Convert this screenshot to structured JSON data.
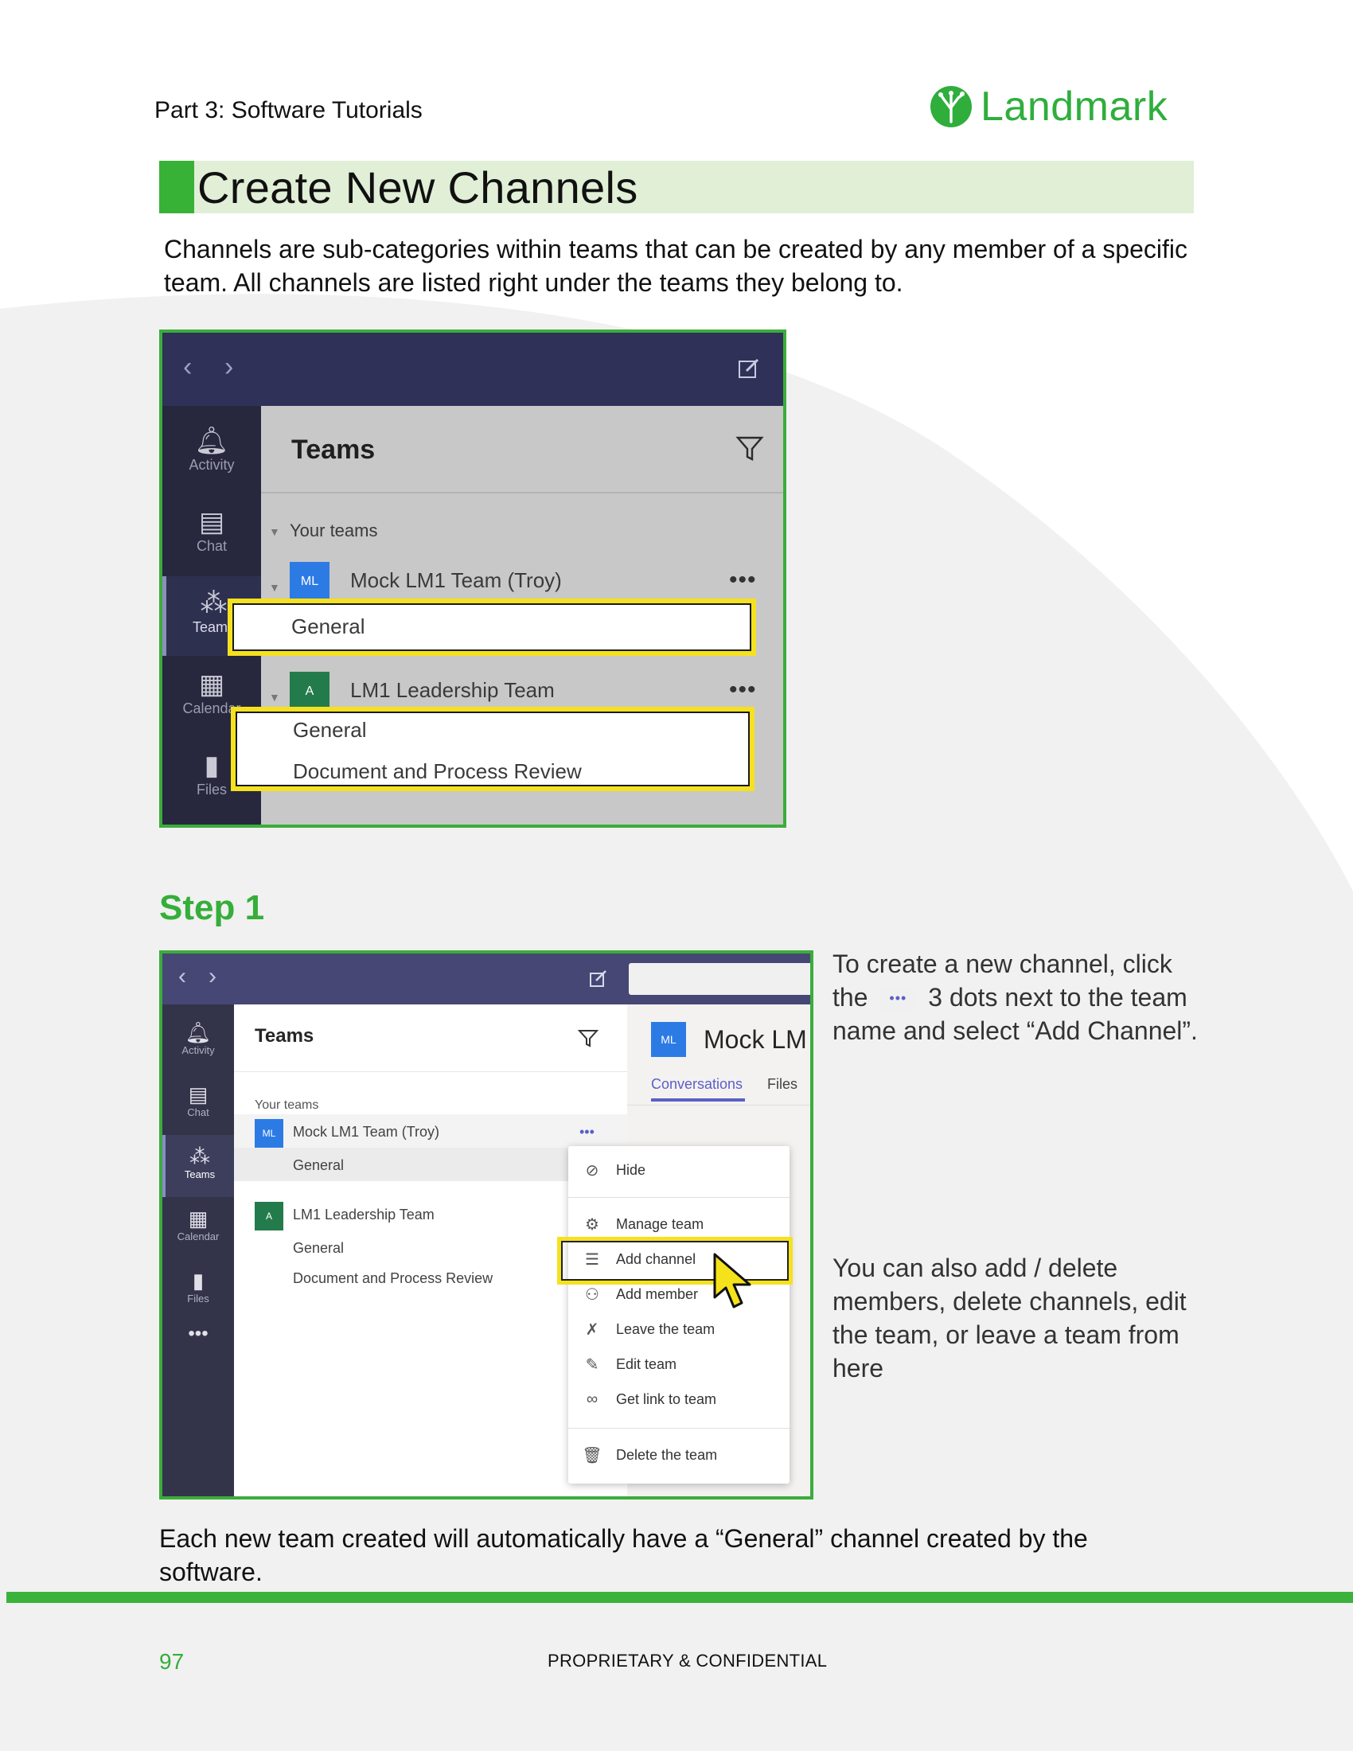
{
  "header": {
    "section_label": "Part 3: Software Tutorials",
    "logo_text": "Landmark",
    "logo_icon": "tree-icon"
  },
  "title": "Create New Channels",
  "intro": "Channels are sub-categories within teams that can be created by any member of a specific team. All channels are listed right under the teams they belong to.",
  "screenshot1": {
    "rail": [
      "Activity",
      "Chat",
      "Teams",
      "Calendar",
      "Files"
    ],
    "heading": "Teams",
    "section": "Your teams",
    "team1": {
      "avatar": "ML",
      "name": "Mock LM1 Team (Troy)",
      "channels": [
        "General"
      ]
    },
    "team2": {
      "avatar": "A",
      "name": "LM1 Leadership Team",
      "channels": [
        "General",
        "Document and Process Review"
      ]
    },
    "more_glyph": "•••"
  },
  "step_heading": "Step 1",
  "screenshot2": {
    "rail": [
      "Activity",
      "Chat",
      "Teams",
      "Calendar",
      "Files"
    ],
    "rail_more": "•••",
    "heading": "Teams",
    "section": "Your teams",
    "team1": {
      "avatar": "ML",
      "name": "Mock LM1 Team (Troy)",
      "channel": "General"
    },
    "team2": {
      "avatar": "A",
      "name": "LM1 Leadership Team",
      "channels": [
        "General",
        "Document and Process Review"
      ]
    },
    "more_glyph": "•••",
    "right_avatar": "ML",
    "right_title": "Mock LM",
    "right_tabs": [
      "Conversations",
      "Files"
    ],
    "menu": [
      "Hide",
      "Manage team",
      "Add channel",
      "Add member",
      "Leave the team",
      "Edit team",
      "Get link to team",
      "Delete the team"
    ]
  },
  "side_text_1": {
    "pre": "To create a new channel, click the",
    "dots": "•••",
    "post": "3 dots next to the team name and select “Add Channel”."
  },
  "side_text_2": "You can also add / delete members, delete channels, edit the team, or leave a team from here",
  "bottom_text": "Each new team created will automatically have a “General” channel created by the software.",
  "footer": {
    "page_number": "97",
    "confidential": "PROPRIETARY & CONFIDENTIAL"
  },
  "colors": {
    "brand_green": "#38b236",
    "title_band": "#e0efd6",
    "highlight_yellow": "#f5e11f",
    "teams_purple": "#464775"
  }
}
